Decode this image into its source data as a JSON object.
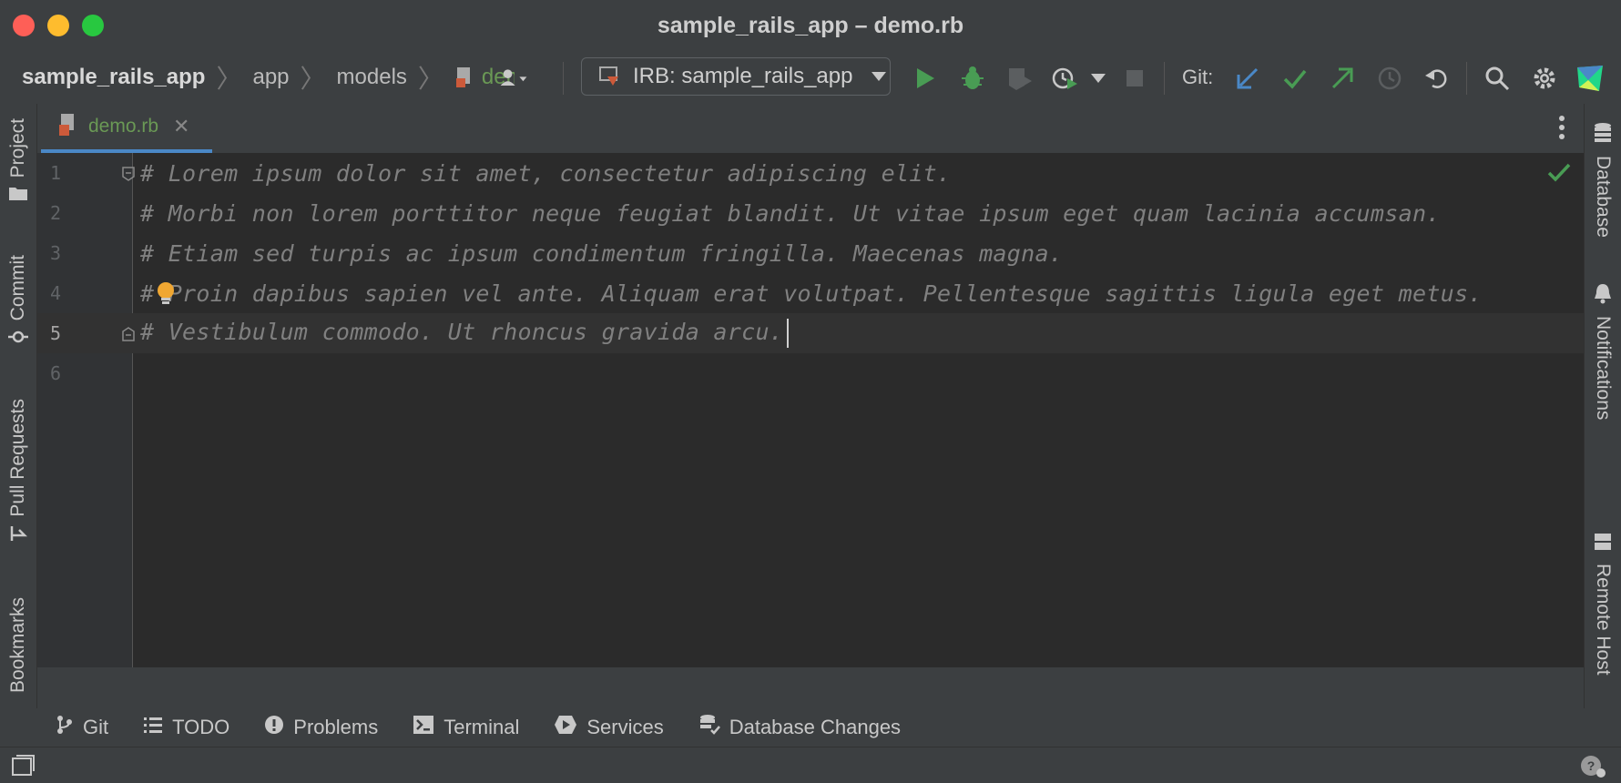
{
  "window": {
    "title": "sample_rails_app – demo.rb"
  },
  "breadcrumb": {
    "project": "sample_rails_app",
    "folder1": "app",
    "folder2": "models",
    "file": "demo.rb"
  },
  "toolbar": {
    "run_config": "IRB: sample_rails_app",
    "git_label": "Git:"
  },
  "left_tools": {
    "project": "Project",
    "commit": "Commit",
    "pull_requests": "Pull Requests",
    "bookmarks": "Bookmarks"
  },
  "right_tools": {
    "database": "Database",
    "notifications": "Notifications",
    "remote_host": "Remote Host"
  },
  "tab": {
    "label": "demo.rb"
  },
  "editor": {
    "lines": [
      {
        "num": "1",
        "text": "# Lorem ipsum dolor sit amet, consectetur adipiscing elit."
      },
      {
        "num": "2",
        "text": "# Morbi non lorem porttitor neque feugiat blandit. Ut vitae ipsum eget quam lacinia accumsan."
      },
      {
        "num": "3",
        "text": "# Etiam sed turpis ac ipsum condimentum fringilla. Maecenas magna."
      },
      {
        "num": "4",
        "text": "# Proin dapibus sapien vel ante. Aliquam erat volutpat. Pellentesque sagittis ligula eget metus."
      },
      {
        "num": "5",
        "text": "# Vestibulum commodo. Ut rhoncus gravida arcu."
      },
      {
        "num": "6",
        "text": ""
      }
    ]
  },
  "bottom_tools": {
    "git": "Git",
    "todo": "TODO",
    "problems": "Problems",
    "terminal": "Terminal",
    "services": "Services",
    "db_changes": "Database Changes"
  },
  "colors": {
    "accent": "#4a88c7",
    "run_green": "#499c54",
    "comment": "#808080"
  }
}
